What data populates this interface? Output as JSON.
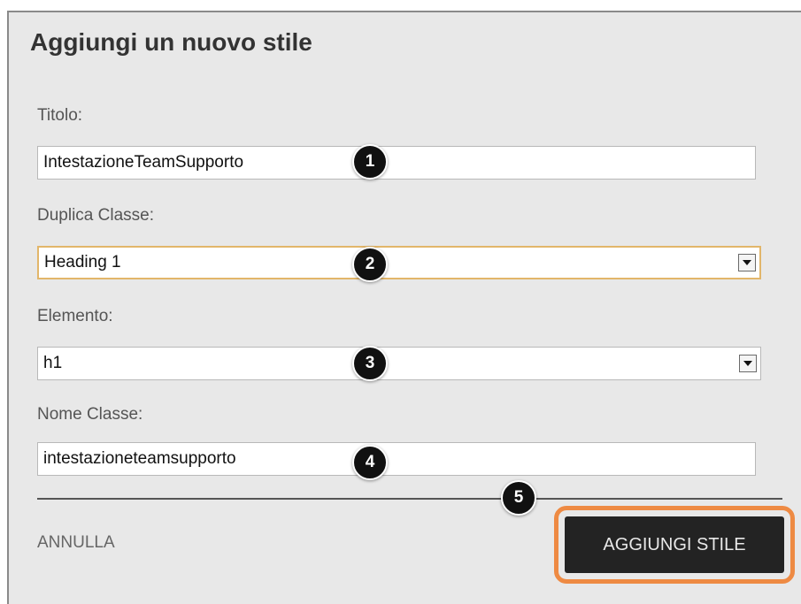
{
  "dialog": {
    "title": "Aggiungi un nuovo stile"
  },
  "fields": {
    "title": {
      "label": "Titolo:",
      "value": "IntestazioneTeamSupporto"
    },
    "duplicate_class": {
      "label": "Duplica Classe:",
      "selected": "Heading 1"
    },
    "element": {
      "label": "Elemento:",
      "selected": "h1"
    },
    "class_name": {
      "label": "Nome Classe:",
      "value": "intestazioneteamsupporto"
    }
  },
  "markers": [
    "1",
    "2",
    "3",
    "4",
    "5"
  ],
  "actions": {
    "cancel_label": "ANNULLA",
    "add_label": "AGGIUNGI STILE"
  },
  "colors": {
    "highlight": "#ee8a43",
    "focus_border": "#e2b66a",
    "button_bg": "#232323"
  }
}
